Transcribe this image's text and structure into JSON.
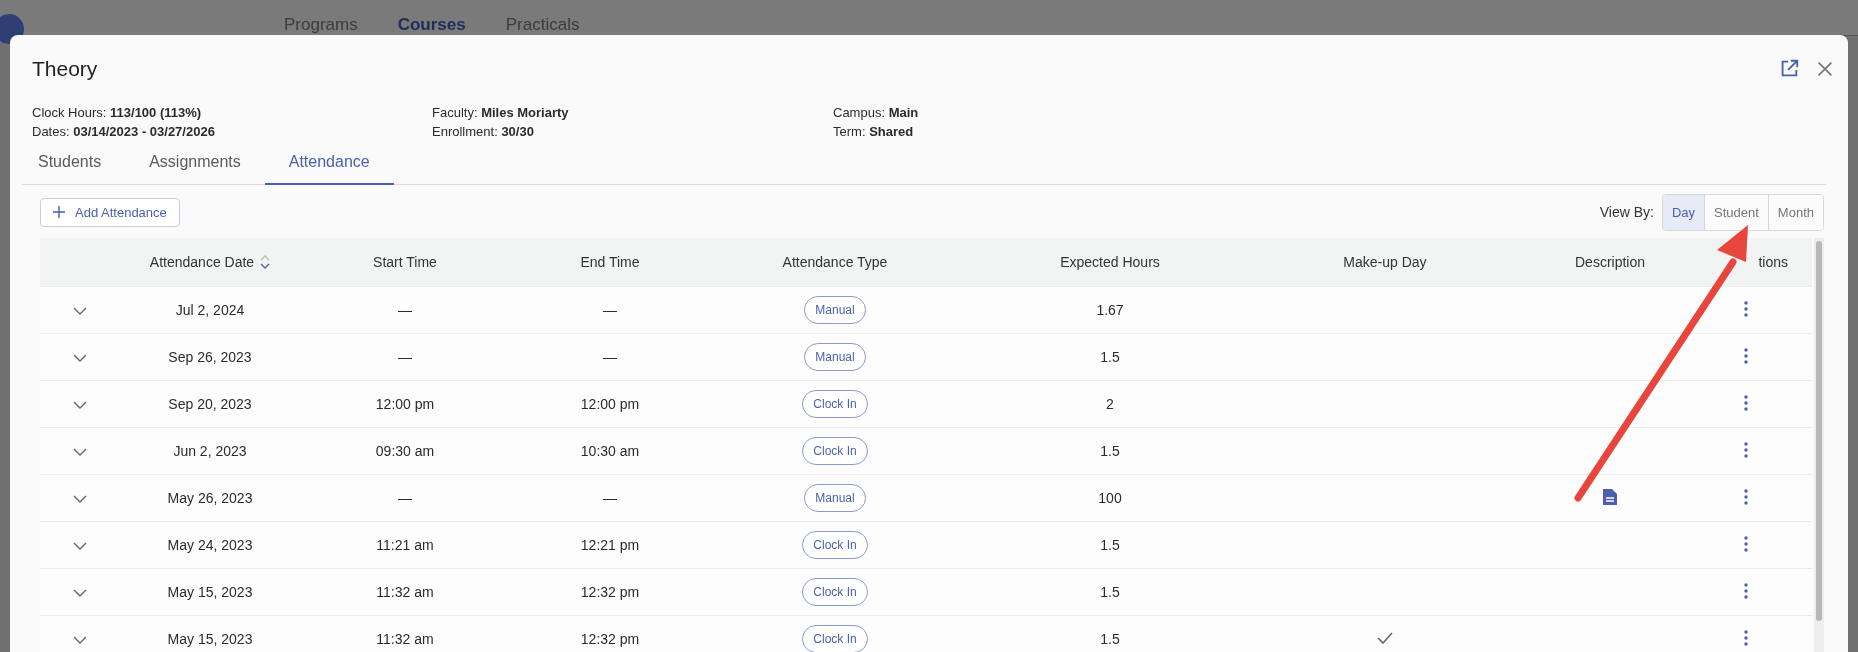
{
  "background_nav": {
    "tabs": [
      {
        "label": "Programs",
        "selected": false
      },
      {
        "label": "Courses",
        "selected": true
      },
      {
        "label": "Practicals",
        "selected": false
      }
    ]
  },
  "dialog": {
    "title": "Theory",
    "info": [
      {
        "label": "Clock Hours:",
        "value": "113/100 (113%)"
      },
      {
        "label": "Faculty:",
        "value": "Miles Moriarty"
      },
      {
        "label": "Campus:",
        "value": "Main"
      },
      {
        "label": "Dates:",
        "value": "03/14/2023 - 03/27/2026"
      },
      {
        "label": "Enrollment:",
        "value": "30/30"
      },
      {
        "label": "Term:",
        "value": "Shared"
      }
    ],
    "tabs": [
      {
        "label": "Students",
        "selected": false
      },
      {
        "label": "Assignments",
        "selected": false
      },
      {
        "label": "Attendance",
        "selected": true
      }
    ],
    "add_button": "Add Attendance",
    "view_by": {
      "label": "View By:",
      "options": [
        {
          "label": "Day",
          "selected": true
        },
        {
          "label": "Student",
          "selected": false
        },
        {
          "label": "Month",
          "selected": false
        }
      ]
    },
    "table": {
      "columns": [
        "Attendance Date",
        "Start Time",
        "End Time",
        "Attendance Type",
        "Expected Hours",
        "Make-up Day",
        "Description",
        "tions"
      ],
      "rows": [
        {
          "date": "Jul 2, 2024",
          "start": "—",
          "end": "—",
          "type": "Manual",
          "expected": "1.67",
          "makeup_day": false,
          "has_description": false
        },
        {
          "date": "Sep 26, 2023",
          "start": "—",
          "end": "—",
          "type": "Manual",
          "expected": "1.5",
          "makeup_day": false,
          "has_description": false
        },
        {
          "date": "Sep 20, 2023",
          "start": "12:00 pm",
          "end": "12:00 pm",
          "type": "Clock In",
          "expected": "2",
          "makeup_day": false,
          "has_description": false
        },
        {
          "date": "Jun 2, 2023",
          "start": "09:30 am",
          "end": "10:30 am",
          "type": "Clock In",
          "expected": "1.5",
          "makeup_day": false,
          "has_description": false
        },
        {
          "date": "May 26, 2023",
          "start": "—",
          "end": "—",
          "type": "Manual",
          "expected": "100",
          "makeup_day": false,
          "has_description": true
        },
        {
          "date": "May 24, 2023",
          "start": "11:21 am",
          "end": "12:21 pm",
          "type": "Clock In",
          "expected": "1.5",
          "makeup_day": false,
          "has_description": false
        },
        {
          "date": "May 15, 2023",
          "start": "11:32 am",
          "end": "12:32 pm",
          "type": "Clock In",
          "expected": "1.5",
          "makeup_day": false,
          "has_description": false
        },
        {
          "date": "May 15, 2023",
          "start": "11:32 am",
          "end": "12:32 pm",
          "type": "Clock In",
          "expected": "1.5",
          "makeup_day": true,
          "has_description": false
        }
      ]
    }
  }
}
